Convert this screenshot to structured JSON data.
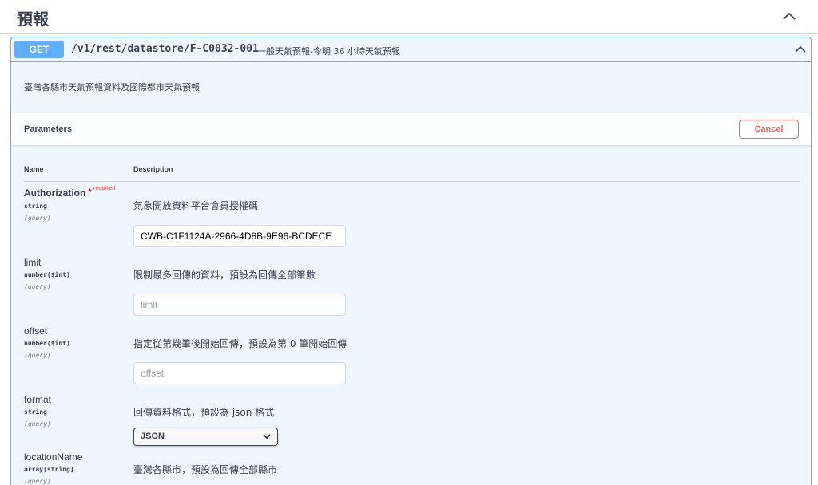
{
  "section": {
    "title": "預報"
  },
  "operation": {
    "method": "GET",
    "path": "/v1/rest/datastore/F-C0032-001",
    "summary": "一般天氣預報-今明 36 小時天氣預報",
    "description": "臺灣各縣市天氣預報資料及國際都市天氣預報"
  },
  "parameters_bar": {
    "title": "Parameters",
    "cancel_label": "Cancel"
  },
  "columns": {
    "name": "Name",
    "description": "Description"
  },
  "params": [
    {
      "name": "Authorization",
      "required_star": "*",
      "required_text": "required",
      "type": "string",
      "in": "(query)",
      "description": "氣象開放資料平台會員授權碼",
      "value": "CWB-C1F1124A-2966-4D8B-9E96-BCDECE"
    },
    {
      "name": "limit",
      "type": "number($int)",
      "in": "(query)",
      "description": "限制最多回傳的資料，預設為回傳全部筆數",
      "placeholder": "limit"
    },
    {
      "name": "offset",
      "type": "number($int)",
      "in": "(query)",
      "description": "指定從第幾筆後開始回傳，預設為第 0 筆開始回傳",
      "placeholder": "offset"
    },
    {
      "name": "format",
      "type": "string",
      "in": "(query)",
      "description": "回傳資料格式，預設為 json 格式",
      "selected": "JSON"
    },
    {
      "name": "locationName",
      "type": "array[string]",
      "in": "(query)",
      "description": "臺灣各縣市，預設為回傳全部縣市"
    }
  ],
  "colors": {
    "get_blue": "#61affe",
    "get_bg": "#eff6fe",
    "cancel_red": "#ff6060",
    "text": "#3b4151"
  }
}
